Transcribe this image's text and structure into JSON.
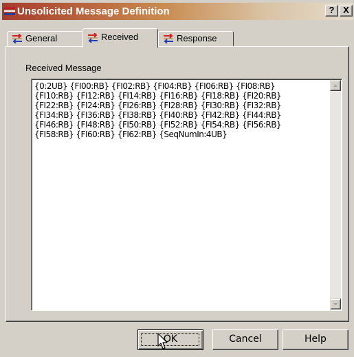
{
  "window": {
    "title": "Unsolicited Message Definition",
    "help_label": "?",
    "close_label": "X",
    "title_icon": "tab-arrows-icon"
  },
  "tabs": [
    {
      "label": "General",
      "icon": "tab-arrows-icon",
      "selected": false
    },
    {
      "label": "Received",
      "icon": "tab-arrows-icon",
      "selected": true
    },
    {
      "label": "Response",
      "icon": "tab-arrows-icon",
      "selected": false
    }
  ],
  "received_message": {
    "label": "Received Message",
    "lines": [
      "{0:2UB} {FI00:RB} {FI02:RB} {FI04:RB} {FI06:RB} {FI08:RB}",
      "{FI10:RB} {FI12:RB} {FI14:RB} {FI16:RB} {FI18:RB} {FI20:RB}",
      "{FI22:RB} {FI24:RB} {FI26:RB} {FI28:RB} {FI30:RB} {FI32:RB}",
      "{FI34:RB} {FI36:RB} {FI38:RB} {FI40:RB} {FI42:RB} {FI44:RB}",
      "{FI46:RB} {FI48:RB} {FI50:RB} {FI52:RB} {FI54:RB} {FI56:RB}",
      "{FI58:RB} {FI60:RB} {FI62:RB} {SeqNumIn:4UB}"
    ]
  },
  "buttons": {
    "ok": "OK",
    "cancel": "Cancel",
    "help": "Help"
  },
  "colors": {
    "titlebar_start": "#a63c2c",
    "titlebar_end": "#e6dccd",
    "face": "#d4d0c8"
  }
}
